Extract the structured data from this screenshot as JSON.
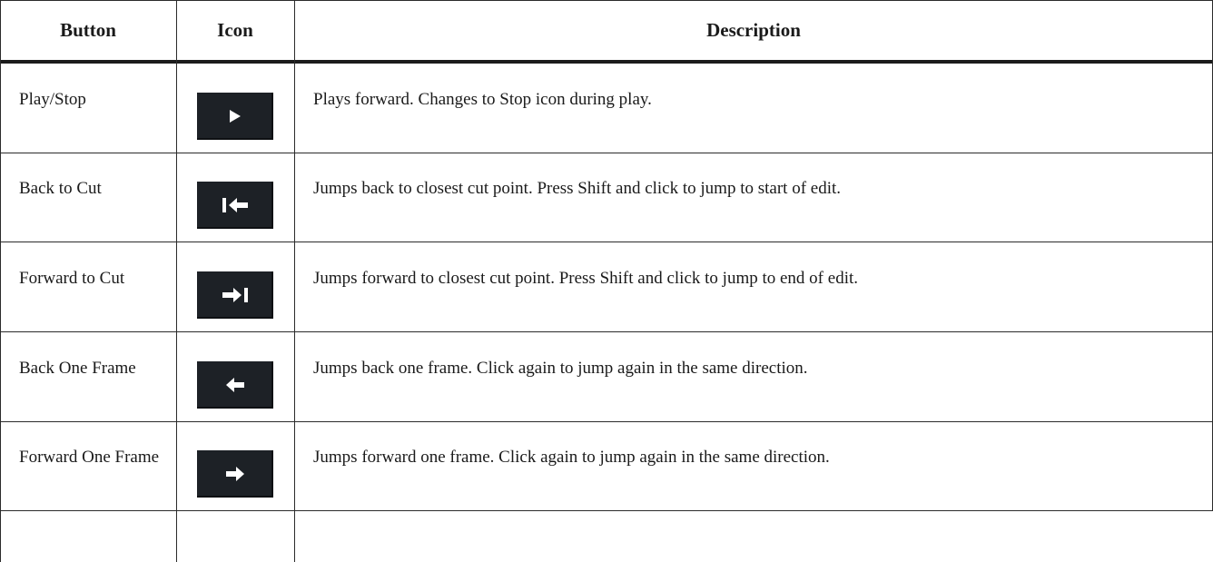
{
  "table": {
    "headers": {
      "button": "Button",
      "icon": "Icon",
      "description": "Description"
    },
    "rows": [
      {
        "button": "Play/Stop",
        "icon": "play-icon",
        "description": "Plays forward. Changes to Stop icon during play."
      },
      {
        "button": "Back to Cut",
        "icon": "back-to-cut-icon",
        "description": "Jumps back to closest cut point. Press Shift and click to jump to start of edit."
      },
      {
        "button": "Forward to Cut",
        "icon": "forward-to-cut-icon",
        "description": "Jumps forward to closest cut point. Press Shift and click to jump to end of edit."
      },
      {
        "button": "Back One Frame",
        "icon": "back-one-frame-icon",
        "description": "Jumps back one frame. Click again to jump again in the same direction."
      },
      {
        "button": "Forward One Frame",
        "icon": "forward-one-frame-icon",
        "description": "Jumps forward one frame. Click again to jump again in the same direction."
      }
    ]
  },
  "colors": {
    "icon_background": "#1d2126",
    "icon_glyph": "#ffffff",
    "rule": "#2b2b2b"
  }
}
